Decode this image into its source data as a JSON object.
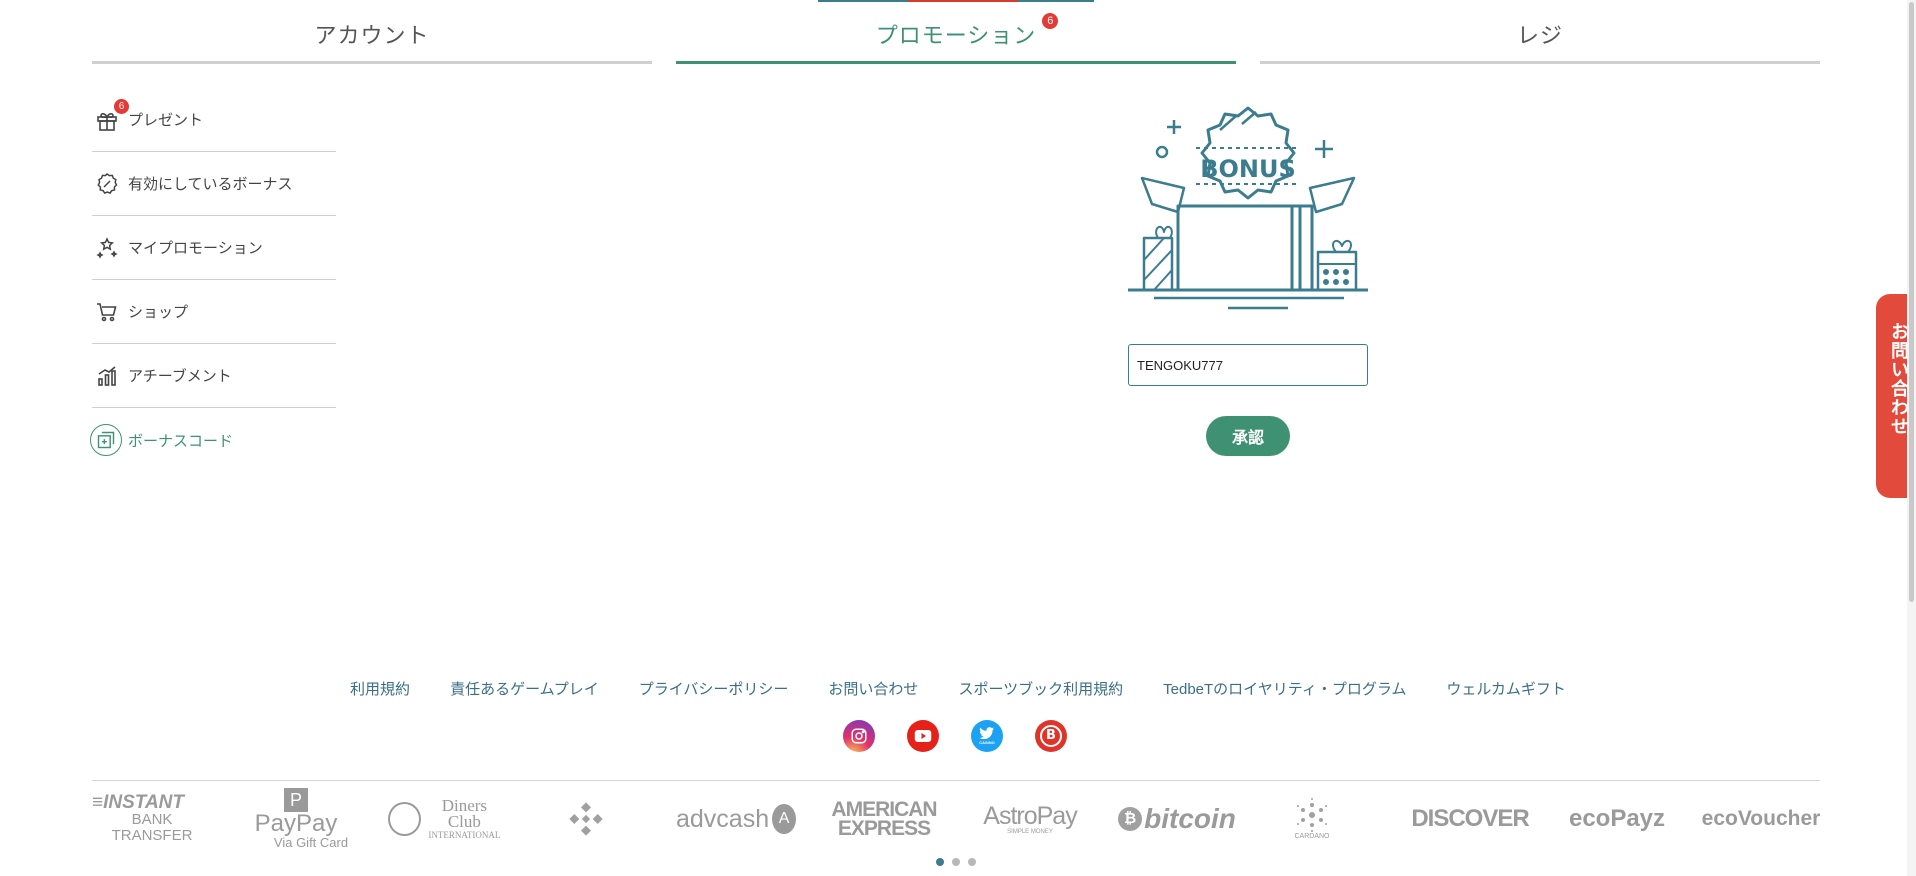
{
  "tabs": [
    {
      "label": "アカウント",
      "active": false
    },
    {
      "label": "プロモーション",
      "active": true,
      "badge": "6"
    },
    {
      "label": "レジ",
      "active": false
    }
  ],
  "menu": [
    {
      "label": "プレゼント",
      "icon": "gift-icon",
      "badge": "6"
    },
    {
      "label": "有効にしているボーナス",
      "icon": "badge-check-icon"
    },
    {
      "label": "マイプロモーション",
      "icon": "sparkle-stars-icon"
    },
    {
      "label": "ショップ",
      "icon": "cart-icon"
    },
    {
      "label": "アチーブメント",
      "icon": "bar-chart-icon"
    },
    {
      "label": "ボーナスコード",
      "icon": "bonus-code-icon",
      "active": true
    }
  ],
  "bonus": {
    "banner_text": "BONUS",
    "code_value": "TENGOKU777",
    "approve_label": "承認"
  },
  "contact_tab": "お問い合わせ",
  "footer": {
    "links": [
      "利用規約",
      "責任あるゲームプレイ",
      "プライバシーポリシー",
      "お問い合わせ",
      "スポーツブック利用規約",
      "TedbeTのロイヤリティ・プログラム",
      "ウェルカムギフト"
    ],
    "social": [
      {
        "icon": "instagram-icon",
        "color": "#c13584"
      },
      {
        "icon": "youtube-icon",
        "color": "#e62117"
      },
      {
        "icon": "twitter-icon",
        "color": "#1da1f2",
        "caption": "CASINO"
      },
      {
        "icon": "b-logo-icon",
        "color": "#e0342a",
        "letter": "B"
      }
    ]
  },
  "payments": [
    {
      "line1": "≡INSTANT",
      "line2": "BANK TRANSFER"
    },
    {
      "line1": "PayPay",
      "line2": "Via Gift Card"
    },
    {
      "line1": "Diners Club",
      "line2": "INTERNATIONAL"
    },
    {
      "line1": "",
      "line2": ""
    },
    {
      "line1": "advcash",
      "line2": ""
    },
    {
      "line1": "AMERICAN",
      "line2": "EXPRESS"
    },
    {
      "line1": "AstroPay",
      "line2": "SIMPLE MONEY"
    },
    {
      "line1": "bitcoin",
      "line2": ""
    },
    {
      "line1": "",
      "line2": "CARDANO"
    },
    {
      "line1": "DISCOVER",
      "line2": ""
    },
    {
      "line1": "ecoPayz",
      "line2": ""
    },
    {
      "line1": "ecoVoucher",
      "line2": ""
    }
  ],
  "carousel": {
    "pages": 3,
    "active": 0
  },
  "colors": {
    "accent": "#3e9173",
    "teal": "#3b7d8f",
    "badge": "#e53935",
    "contact": "#e24a3b",
    "link": "#3a6f86"
  }
}
